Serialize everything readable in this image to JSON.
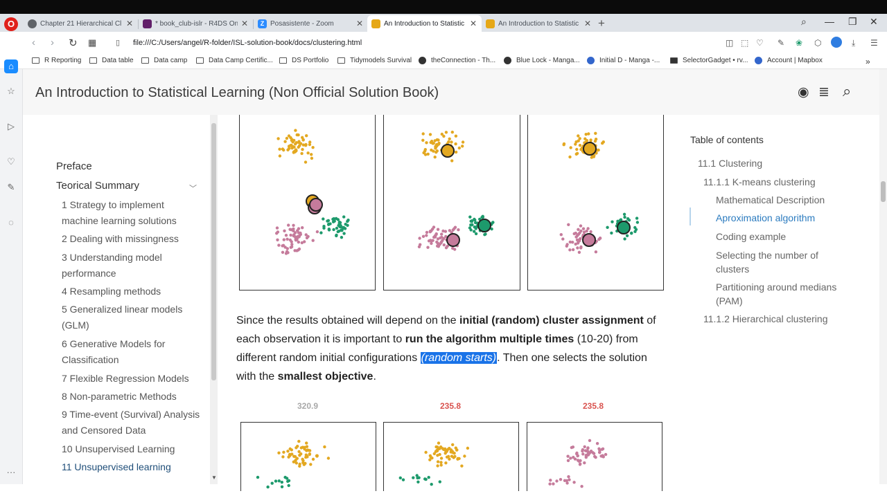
{
  "browser": {
    "tabs": [
      {
        "label": "Chapter 21 Hierarchical Cl",
        "favicon_color": "#5f6368",
        "active": false
      },
      {
        "label": "* book_club-islr - R4DS On",
        "favicon_color": "#611f69",
        "active": false
      },
      {
        "label": "Posasistente - Zoom",
        "favicon_color": "#2d8cff",
        "favicon_glyph": "Z",
        "active": false
      },
      {
        "label": "An Introduction to Statistic",
        "favicon_color": "#e6a817",
        "active": true
      },
      {
        "label": "An Introduction to Statistic",
        "favicon_color": "#e6a817",
        "active": false
      }
    ],
    "url": "file:///C:/Users/angel/R-folder/ISL-solution-book/docs/clustering.html",
    "bookmarks": [
      {
        "label": "R Reporting",
        "icon": "folder-icon"
      },
      {
        "label": "Data table",
        "icon": "folder-icon"
      },
      {
        "label": "Data camp",
        "icon": "folder-icon"
      },
      {
        "label": "Data Camp Certific...",
        "icon": "folder-icon"
      },
      {
        "label": "DS Portfolio",
        "icon": "folder-icon"
      },
      {
        "label": "Tidymodels Survival",
        "icon": "folder-icon"
      },
      {
        "label": "theConnection - Th...",
        "icon": "github-icon"
      },
      {
        "label": "Blue Lock - Manga...",
        "icon": "manga-icon"
      },
      {
        "label": "Initial D - Manga -...",
        "icon": "manga-icon"
      },
      {
        "label": "SelectorGadget • rv...",
        "icon": "page-icon"
      },
      {
        "label": "Account | Mapbox",
        "icon": "mapbox-icon"
      }
    ]
  },
  "site": {
    "title": "An Introduction to Statistical Learning (Non Official Solution Book)"
  },
  "nav": {
    "preface": "Preface",
    "teorical": "Teorical Summary",
    "items": [
      "1 Strategy to implement machine learning solutions",
      "2 Dealing with missingness",
      "3 Understanding model performance",
      "4 Resampling methods",
      "5 Generalized linear models (GLM)",
      "6 Generative Models for Classification",
      "7 Flexible Regression Models",
      "8 Non-parametric Methods",
      "9 Time-event (Survival) Analysis and Censored Data",
      "10 Unsupervised Learning",
      "11 Unsupervised learning"
    ]
  },
  "content": {
    "para": {
      "t1": "Since the results obtained will depend on the ",
      "b1": "initial (random) cluster assignment",
      "t2": " of each observation it is important to ",
      "b2": "run the algorithm multiple times",
      "t3": " (10-20) from different random initial configurations ",
      "hl": "(random starts)",
      "t4": ". Then one selects the solution with the ",
      "b3": "smallest objective",
      "t5": "."
    },
    "costs": [
      {
        "value": "320.9",
        "color": "#a8a8a8"
      },
      {
        "value": "235.8",
        "color": "#d9534f"
      },
      {
        "value": "235.8",
        "color": "#d9534f"
      }
    ],
    "colors": {
      "gold": "#e3a821",
      "pink": "#c57b9b",
      "green": "#1d9a6c"
    }
  },
  "toc": {
    "title": "Table of contents",
    "items": [
      {
        "label": "11.1 Clustering"
      },
      {
        "label": "11.1.1 K-means clustering"
      },
      {
        "label": "Mathematical Description"
      },
      {
        "label": "Aproximation algorithm"
      },
      {
        "label": "Coding example"
      },
      {
        "label": "Selecting the number of clusters"
      },
      {
        "label": "Partitioning around medians (PAM)"
      },
      {
        "label": "11.1.2 Hierarchical clustering"
      }
    ]
  }
}
